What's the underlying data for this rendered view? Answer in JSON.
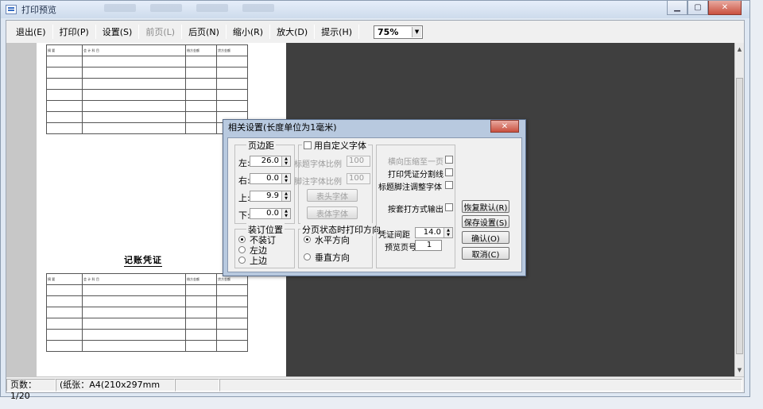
{
  "window": {
    "title": "打印预览"
  },
  "toolbar": {
    "exit": "退出(E)",
    "print": "打印(P)",
    "settings": "设置(S)",
    "prev": "前页(L)",
    "next": "后页(N)",
    "zoom_out": "缩小(R)",
    "zoom_in": "放大(D)",
    "hint": "提示(H)",
    "zoom_value": "75%"
  },
  "preview": {
    "voucher_title": "记账凭证",
    "headers": [
      "摘 要",
      "会 计 科 目",
      "借方金额",
      "贷方金额"
    ]
  },
  "status": {
    "page": "页数：1/20",
    "paper": "(纸张：A4(210x297mm"
  },
  "dialog": {
    "title": "相关设置(长度单位为1毫米)",
    "margins": {
      "label": "页边距",
      "left_label": "左:",
      "left": "26.0",
      "right_label": "右:",
      "right": "0.0",
      "top_label": "上:",
      "top": "9.9",
      "bottom_label": "下:",
      "bottom": "0.0"
    },
    "custom_font": {
      "label": "用自定义字体",
      "title_ratio_label": "标题字体比例",
      "title_ratio": "100",
      "foot_ratio_label": "脚注字体比例",
      "foot_ratio": "100",
      "header_font": "表头字体",
      "body_font": "表体字体"
    },
    "binding": {
      "label": "装订位置",
      "options": [
        "不装订",
        "左边",
        "上边"
      ]
    },
    "direction": {
      "label": "分页状态时打印方向",
      "options": [
        "水平方向",
        "垂直方向"
      ]
    },
    "checks": {
      "compress": "横向压缩至一页",
      "split_line": "打印凭证分割线",
      "adjust_font": "标题脚注调整字体",
      "overlay": "按套打方式输出"
    },
    "spacing_label": "凭证间距",
    "spacing": "14.0",
    "preview_page_label": "预览页号",
    "preview_page": "1",
    "buttons": {
      "restore": "恢复默认(R)",
      "save": "保存设置(S)",
      "ok": "确认(O)",
      "cancel": "取消(C)"
    }
  }
}
